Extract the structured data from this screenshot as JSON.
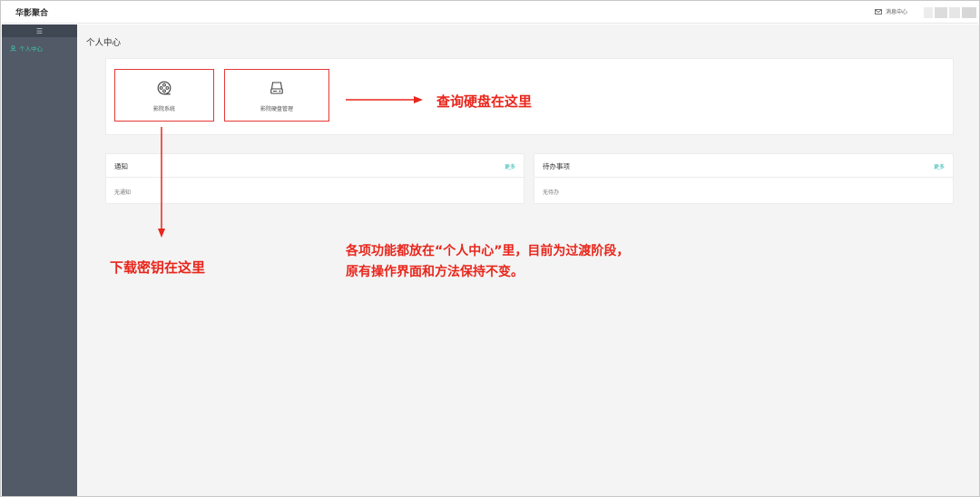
{
  "header": {
    "app_title": "华影聚合",
    "message_center": "消息中心"
  },
  "sidebar": {
    "toggle_icon": "hamburger-icon",
    "items": [
      {
        "label": "个人中心",
        "icon": "user-icon",
        "active": true
      }
    ]
  },
  "main": {
    "page_title": "个人中心",
    "apps": [
      {
        "label": "影院系统",
        "icon": "film-reel-icon"
      },
      {
        "label": "影院硬盘管理",
        "icon": "hard-disk-icon"
      }
    ],
    "notice_panel": {
      "title": "通知",
      "more": "更多",
      "empty_text": "无通知"
    },
    "todo_panel": {
      "title": "待办事项",
      "more": "更多",
      "empty_text": "无待办"
    }
  },
  "annotations": {
    "harddisk_hint": "查询硬盘在这里",
    "key_hint": "下载密钥在这里",
    "note_line1": "各项功能都放在“个人中心”里，目前为过渡阶段，",
    "note_line2": "原有操作界面和方法保持不变。",
    "color": "#e8261c"
  },
  "colors": {
    "sidebar_bg": "#515a66",
    "accent": "#3ec5b2",
    "highlight_border": "#e53935"
  }
}
